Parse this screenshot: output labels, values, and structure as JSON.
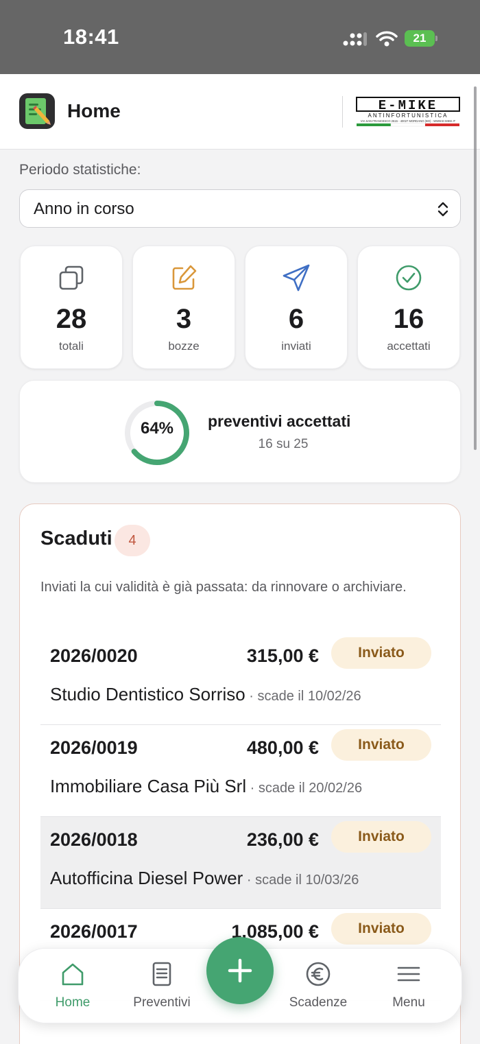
{
  "status_bar": {
    "time": "18:41",
    "battery": "21"
  },
  "header": {
    "title": "Home",
    "brand_name": "E-MIKE",
    "brand_tagline": "ANTINFORTUNISTICA",
    "brand_address": "VIA SAN FRANCESCO 2615 - 40027 MORDANO (BO) - WWW.E-MIKE.IT"
  },
  "period": {
    "label": "Periodo statistiche:",
    "selected": "Anno in corso"
  },
  "stats": [
    {
      "value": "28",
      "label": "totali",
      "icon": "copy-icon"
    },
    {
      "value": "3",
      "label": "bozze",
      "icon": "edit-icon"
    },
    {
      "value": "6",
      "label": "inviati",
      "icon": "send-icon"
    },
    {
      "value": "16",
      "label": "accettati",
      "icon": "check-circle-icon"
    }
  ],
  "acceptance": {
    "percent_text": "64%",
    "percent": 64,
    "title": "preventivi accettati",
    "subtitle": "16 su 25"
  },
  "expired": {
    "title": "Scaduti",
    "count": "4",
    "description": "Inviati la cui validità è già passata: da rinnovare o archiviare.",
    "items": [
      {
        "number": "2026/0020",
        "amount": "315,00 €",
        "status": "Inviato",
        "client": "Studio Dentistico Sorriso",
        "due": " · scade il 10/02/26"
      },
      {
        "number": "2026/0019",
        "amount": "480,00 €",
        "status": "Inviato",
        "client": "Immobiliare Casa Più Srl",
        "due": " · scade il 20/02/26"
      },
      {
        "number": "2026/0018",
        "amount": "236,00 €",
        "status": "Inviato",
        "client": "Autofficina Diesel Power",
        "due": " · scade il 10/03/26"
      },
      {
        "number": "2026/0017",
        "amount": "1.085,00 €",
        "status": "Inviato",
        "client": "",
        "due": ""
      }
    ]
  },
  "colors": {
    "accent": "#45a572",
    "status_bg": "#666666",
    "expired_badge": "#c0573f",
    "sent_badge_bg": "#fbf0dd"
  },
  "nav": {
    "home": "Home",
    "quotes": "Preventivi",
    "deadlines": "Scadenze",
    "menu": "Menu"
  }
}
